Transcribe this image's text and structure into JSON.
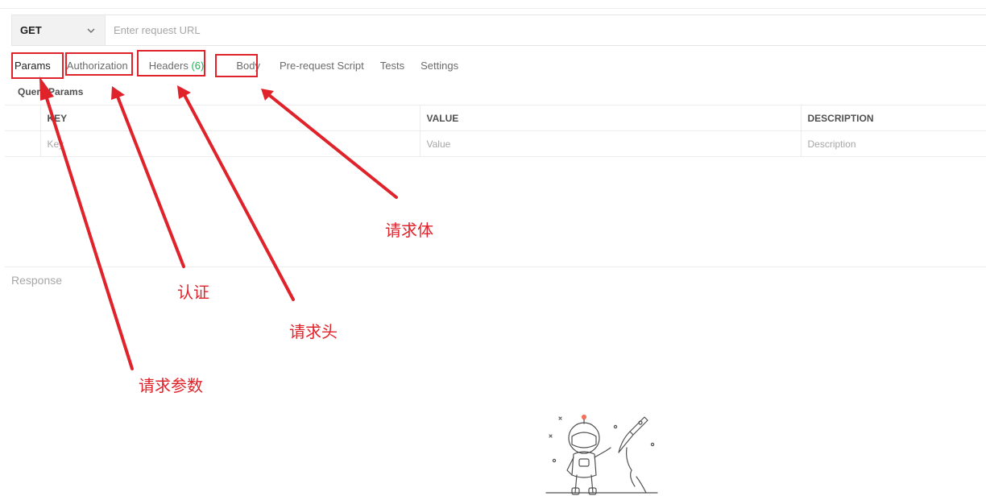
{
  "request": {
    "method": "GET",
    "url_placeholder": "Enter request URL"
  },
  "tabs": [
    {
      "label": "Params",
      "active": true
    },
    {
      "label": "Authorization"
    },
    {
      "label": "Headers",
      "count": "(6)"
    },
    {
      "label": "Body"
    },
    {
      "label": "Pre-request Script"
    },
    {
      "label": "Tests"
    },
    {
      "label": "Settings"
    }
  ],
  "params": {
    "section_label": "Query Params",
    "columns": [
      "KEY",
      "VALUE",
      "DESCRIPTION"
    ],
    "placeholders": [
      "Key",
      "Value",
      "Description"
    ]
  },
  "response": {
    "label": "Response"
  },
  "annotations": {
    "params": "请求参数",
    "authorization": "认证",
    "headers": "请求头",
    "body": "请求体"
  },
  "colors": {
    "annotation": "#e0222a",
    "headers_count": "#0cbb52"
  }
}
